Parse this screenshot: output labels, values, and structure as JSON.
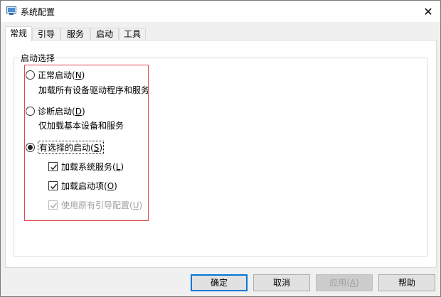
{
  "window": {
    "title": "系统配置",
    "close_glyph": "✕"
  },
  "tabs": [
    {
      "label": "常规",
      "active": true
    },
    {
      "label": "引导",
      "active": false
    },
    {
      "label": "服务",
      "active": false
    },
    {
      "label": "启动",
      "active": false
    },
    {
      "label": "工具",
      "active": false
    }
  ],
  "startup": {
    "group_title": "启动选择",
    "normal": {
      "label": "正常启动(",
      "key": "N",
      "end": ")",
      "desc": "加载所有设备驱动程序和服务",
      "checked": false
    },
    "diagnostic": {
      "label": "诊断启动(",
      "key": "D",
      "end": ")",
      "desc": "仅加载基本设备和服务",
      "checked": false
    },
    "selective": {
      "label": "有选择的启动(",
      "key": "S",
      "end": ")",
      "checked": true
    },
    "load_services": {
      "label": "加载系统服务(",
      "key": "L",
      "end": ")",
      "checked": true
    },
    "load_startup": {
      "label": "加载启动项(",
      "key": "O",
      "end": ")",
      "checked": true
    },
    "use_original_boot": {
      "label": "使用原有引导配置(",
      "key": "U",
      "end": ")",
      "checked": true,
      "disabled": true
    }
  },
  "buttons": {
    "ok": "确定",
    "cancel": "取消",
    "apply": {
      "label": "应用(",
      "key": "A",
      "end": ")"
    },
    "help": "帮助"
  },
  "colors": {
    "highlight_border": "#e0484f",
    "default_button_border": "#0078d7"
  }
}
